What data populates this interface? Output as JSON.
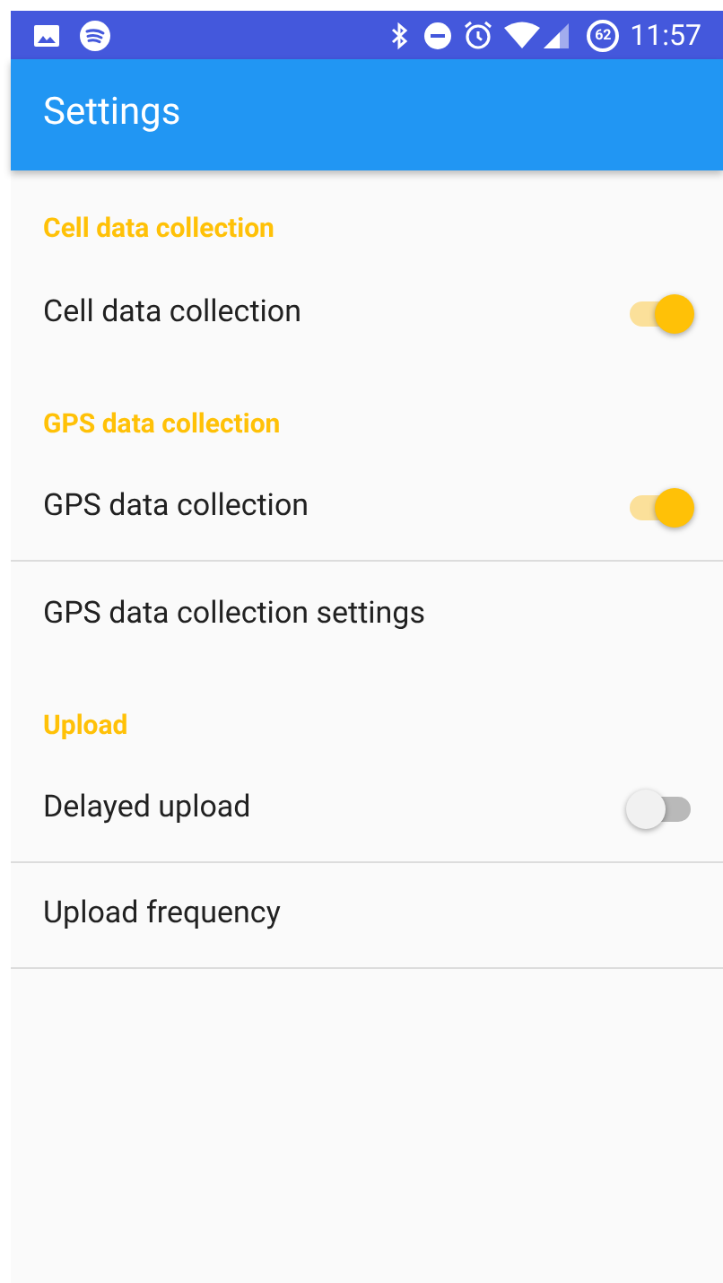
{
  "status_bar": {
    "battery_text": "62",
    "time": "11:57"
  },
  "app_bar": {
    "title": "Settings"
  },
  "items": [
    {
      "kind": "header",
      "label": "Cell data collection",
      "divider": false
    },
    {
      "kind": "switch",
      "label": "Cell data collection",
      "on": true,
      "divider": false
    },
    {
      "kind": "header",
      "label": "GPS data collection",
      "divider": false
    },
    {
      "kind": "switch",
      "label": "GPS data collection",
      "on": true,
      "divider": true
    },
    {
      "kind": "link",
      "label": "GPS data collection settings",
      "divider": false
    },
    {
      "kind": "header",
      "label": "Upload",
      "divider": false
    },
    {
      "kind": "switch",
      "label": "Delayed upload",
      "on": false,
      "divider": true
    },
    {
      "kind": "link",
      "label": "Upload frequency",
      "divider": true
    }
  ]
}
